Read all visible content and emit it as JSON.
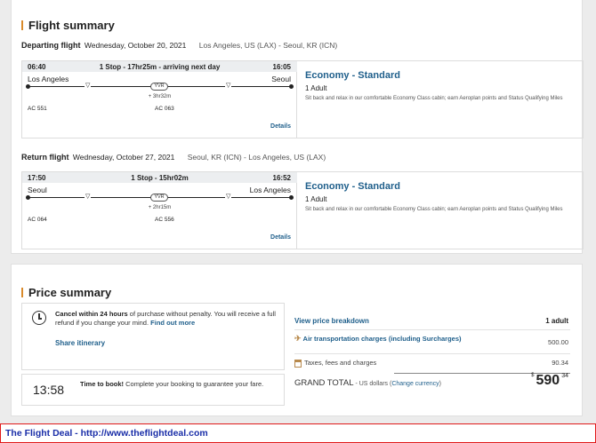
{
  "flight_summary": {
    "title": "Flight summary",
    "legs": [
      {
        "heading": "Departing flight",
        "date": "Wednesday, October 20, 2021",
        "route": "Los Angeles, US (LAX) - Seoul, KR (ICN)",
        "dep_time": "06:40",
        "stop_info": "1 Stop - 17hr25m - arriving next day",
        "arr_time": "16:05",
        "origin": "Los Angeles",
        "destination": "Seoul",
        "via": "YVR",
        "layover": "+ 3hr32m",
        "flight1": "AC 551",
        "flight2": "AC 063",
        "details": "Details",
        "cabin": "Economy - Standard",
        "passengers": "1 Adult",
        "cabin_desc": "Sit back and relax in our comfortable Economy Class cabin; earn Aeroplan points and Status Qualifying Miles"
      },
      {
        "heading": "Return flight",
        "date": "Wednesday, October 27, 2021",
        "route": "Seoul, KR (ICN) - Los Angeles, US (LAX)",
        "dep_time": "17:50",
        "stop_info": "1 Stop - 15hr02m",
        "arr_time": "16:52",
        "origin": "Seoul",
        "destination": "Los Angeles",
        "via": "YVR",
        "layover": "+ 2hr15m",
        "flight1": "AC 064",
        "flight2": "AC 556",
        "details": "Details",
        "cabin": "Economy - Standard",
        "passengers": "1 Adult",
        "cabin_desc": "Sit back and relax in our comfortable Economy Class cabin; earn Aeroplan points and Status Qualifying Miles"
      }
    ]
  },
  "price_summary": {
    "title": "Price summary",
    "cancel_bold": "Cancel within 24 hours",
    "cancel_text": " of purchase without penalty. You will receive a full refund if you change your mind. ",
    "find_out_more": "Find out more",
    "share_itinerary": "Share itinerary",
    "countdown": "13:58",
    "book_bold": "Time to book!",
    "book_text": " Complete your booking to guarantee your fare.",
    "view_breakdown": "View price breakdown",
    "adult_header": "1 adult",
    "air_label": "Air transportation charges (including Surcharges)",
    "air_value": "500.00",
    "tax_label": "Taxes, fees and charges",
    "tax_value": "90.34",
    "grand_total_label": "GRAND TOTAL",
    "currency_text": " - US dollars (",
    "change_currency": "Change currency",
    "currency_close": ")",
    "total_symbol": "$",
    "total_dollars": "590",
    "total_cents": "34"
  },
  "banner": {
    "text": "The Flight Deal - http://www.theflightdeal.com"
  },
  "colors": {
    "link": "#1f5f8b",
    "accent": "#d98a2b",
    "banner_border": "#e01a1a",
    "banner_text": "#1a2ea8"
  }
}
